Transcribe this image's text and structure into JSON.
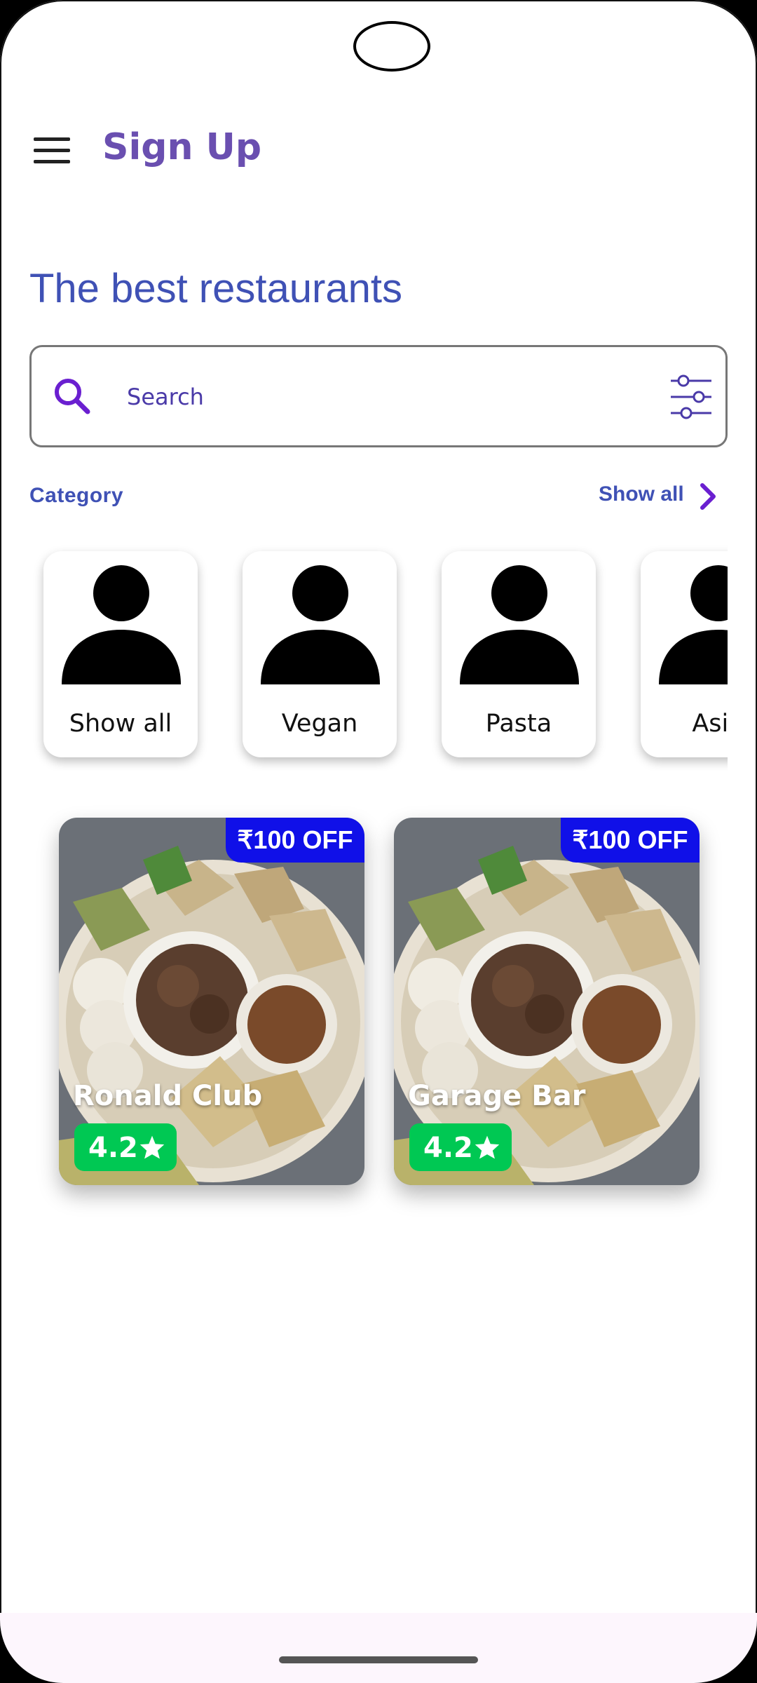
{
  "header": {
    "title": "Sign Up"
  },
  "main": {
    "heading": "The best restaurants",
    "search": {
      "placeholder": "Search",
      "value": ""
    },
    "category_label": "Category",
    "show_all_label": "Show all",
    "categories": [
      {
        "label": "Show all"
      },
      {
        "label": "Vegan"
      },
      {
        "label": "Pasta"
      },
      {
        "label": "Asia"
      }
    ],
    "restaurants": [
      {
        "name": "Ronald Club",
        "offer": "₹100 OFF",
        "rating": "4.2"
      },
      {
        "name": "Garage Bar",
        "offer": "₹100 OFF",
        "rating": "4.2"
      }
    ]
  },
  "colors": {
    "accent": "#6a4fb0",
    "heading": "#3f51b5",
    "offer_badge": "#1010e8",
    "rating_badge": "#00c853"
  },
  "icons": [
    "menu-icon",
    "search-icon",
    "filter-icon",
    "chevron-right-icon",
    "person-icon",
    "star-icon"
  ]
}
